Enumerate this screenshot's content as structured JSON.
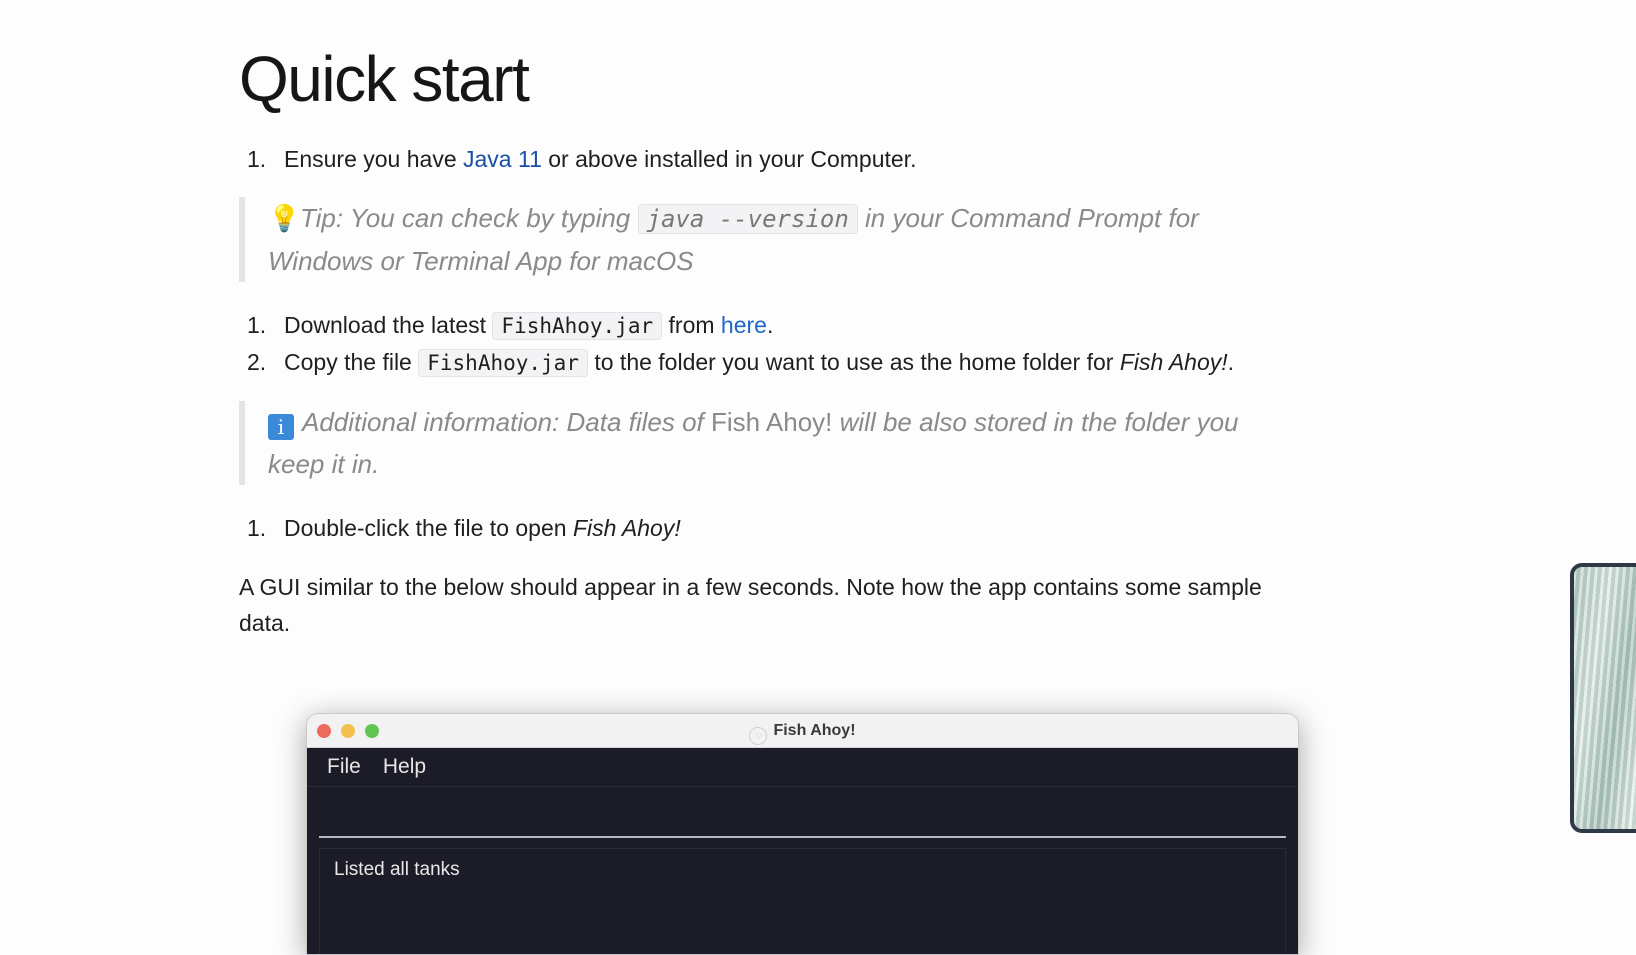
{
  "heading": "Quick start",
  "step1": {
    "num": "1.",
    "before": "Ensure you have ",
    "link": "Java 11",
    "after": " or above installed in your Computer."
  },
  "tip": {
    "label": "Tip: You can check by typing ",
    "code": "java --version",
    "after": " in your Command Prompt for",
    "line2": "Windows or Terminal App for macOS"
  },
  "step2": {
    "num": "1.",
    "before": "Download the latest ",
    "code": "FishAhoy.jar",
    "middle": " from ",
    "link": "here",
    "after": "."
  },
  "step3": {
    "num": "2.",
    "before": "Copy the file ",
    "code": "FishAhoy.jar",
    "middle": " to the folder you want to use as the home folder for ",
    "em": "Fish Ahoy!",
    "after": "."
  },
  "info": {
    "label": "Additional information: Data files of ",
    "name": "Fish Ahoy!",
    "after": " will be also stored in the folder you",
    "line2": "keep it in."
  },
  "step4": {
    "num": "1.",
    "before": "Double-click the file to open ",
    "em": "Fish Ahoy!"
  },
  "paragraph": "A GUI similar to the below should appear in a few seconds. Note how the app contains some sample data.",
  "app": {
    "title": "Fish Ahoy!",
    "menu": [
      "File",
      "Help"
    ],
    "result": "Listed all tanks"
  }
}
